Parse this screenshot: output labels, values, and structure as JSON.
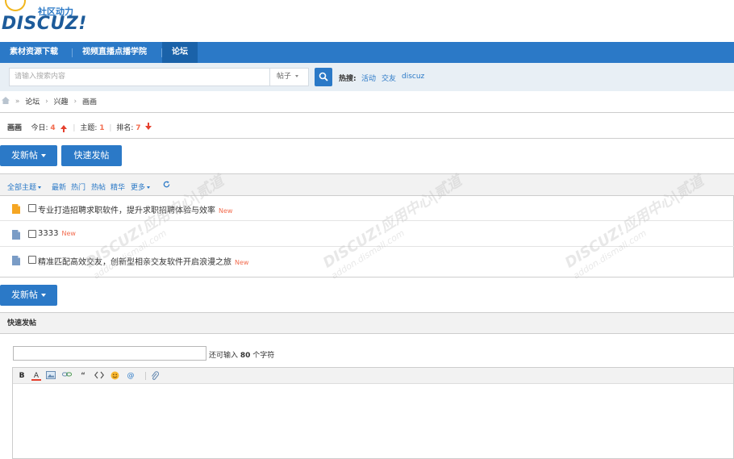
{
  "logo": {
    "brand": "DISCUZ!",
    "subtitle": "社区动力"
  },
  "nav": {
    "items": [
      {
        "label": "素材资源下载"
      },
      {
        "label": "视频直播点播学院"
      },
      {
        "label": "论坛"
      }
    ]
  },
  "search": {
    "placeholder": "请输入搜索内容",
    "type_label": "帖子",
    "hot_label": "热搜:",
    "hot_links": [
      "活动",
      "交友",
      "discuz"
    ]
  },
  "breadcrumb": [
    "论坛",
    "兴趣",
    "画画"
  ],
  "forum_info": {
    "name": "画画",
    "today_label": "今日:",
    "today_value": "4",
    "topics_label": "主题:",
    "topics_value": "1",
    "rank_label": "排名:",
    "rank_value": "7"
  },
  "buttons": {
    "new_post": "发新帖",
    "quick_post": "快速发帖"
  },
  "filters": [
    "全部主题",
    "最新",
    "热门",
    "热帖",
    "精华",
    "更多"
  ],
  "threads": [
    {
      "title": "专业打造招聘求职软件，提升求职招聘体验与效率",
      "badge": "New",
      "icon_color": "#f5a623"
    },
    {
      "title": "3333",
      "badge": "New",
      "icon_color": "#7a9cc6"
    },
    {
      "title": "精准匹配高效交友，创新型相亲交友软件开启浪漫之旅",
      "badge": "New",
      "icon_color": "#7a9cc6"
    }
  ],
  "quick_post": {
    "header": "快速发帖",
    "char_hint_prefix": "还可输入",
    "char_hint_count": "80",
    "char_hint_suffix": "个字符"
  },
  "editor_toolbar": [
    "B",
    "A",
    "image-icon",
    "link-icon",
    "“",
    "code-icon",
    "emoji-icon",
    "@",
    "attach-icon"
  ],
  "watermark": {
    "main": "DISCUZ!应用中心|贰道",
    "sub": "addon.dismall.com"
  },
  "colors": {
    "primary": "#2b79c7",
    "nav_active": "#1a62a9",
    "red": "#e5402e",
    "new_tag": "#f26c4f"
  }
}
